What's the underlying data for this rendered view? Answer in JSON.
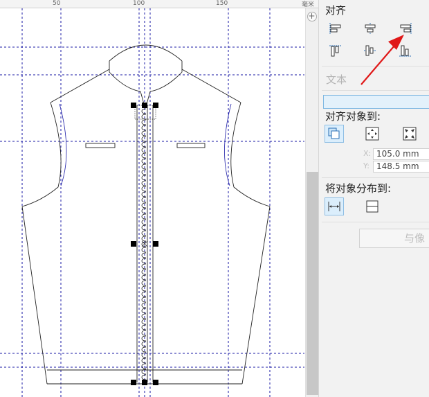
{
  "ruler": {
    "ticks": [
      "50",
      "100",
      "150"
    ],
    "unit": "毫米"
  },
  "canvas": {
    "zoom_button": "+"
  },
  "docker": {
    "align_title": "对齐",
    "align_buttons": [
      {
        "name": "align-left",
        "icon": "align-left-icon"
      },
      {
        "name": "align-center-horizontal",
        "icon": "align-center-horizontal-icon"
      },
      {
        "name": "align-right",
        "icon": "align-right-icon"
      },
      {
        "name": "align-top",
        "icon": "align-top-icon"
      },
      {
        "name": "align-center-vertical",
        "icon": "align-center-vertical-icon"
      },
      {
        "name": "align-bottom",
        "icon": "align-bottom-icon"
      }
    ],
    "text_label": "文本",
    "align_to_title": "对齐对象到:",
    "align_to_buttons": [
      {
        "name": "active-objects",
        "icon": "active-objects-icon",
        "active": true
      },
      {
        "name": "page-edge",
        "icon": "page-edge-icon"
      },
      {
        "name": "page-center",
        "icon": "page-center-icon"
      }
    ],
    "coords": {
      "x_label": "X:",
      "x_value": "105.0 mm",
      "y_label": "Y:",
      "y_value": "148.5 mm"
    },
    "distribute_title": "将对象分布到:",
    "distribute_buttons": [
      {
        "name": "selection-extent",
        "icon": "selection-extent-icon",
        "active": true
      },
      {
        "name": "page-extent",
        "icon": "page-extent-icon"
      }
    ],
    "apply_button": "与像"
  },
  "colors": {
    "guideline": "#1a1aa6",
    "annotation_arrow": "#e01818",
    "active_button_bg": "#dbeefc",
    "active_button_border": "#8ebee4"
  }
}
